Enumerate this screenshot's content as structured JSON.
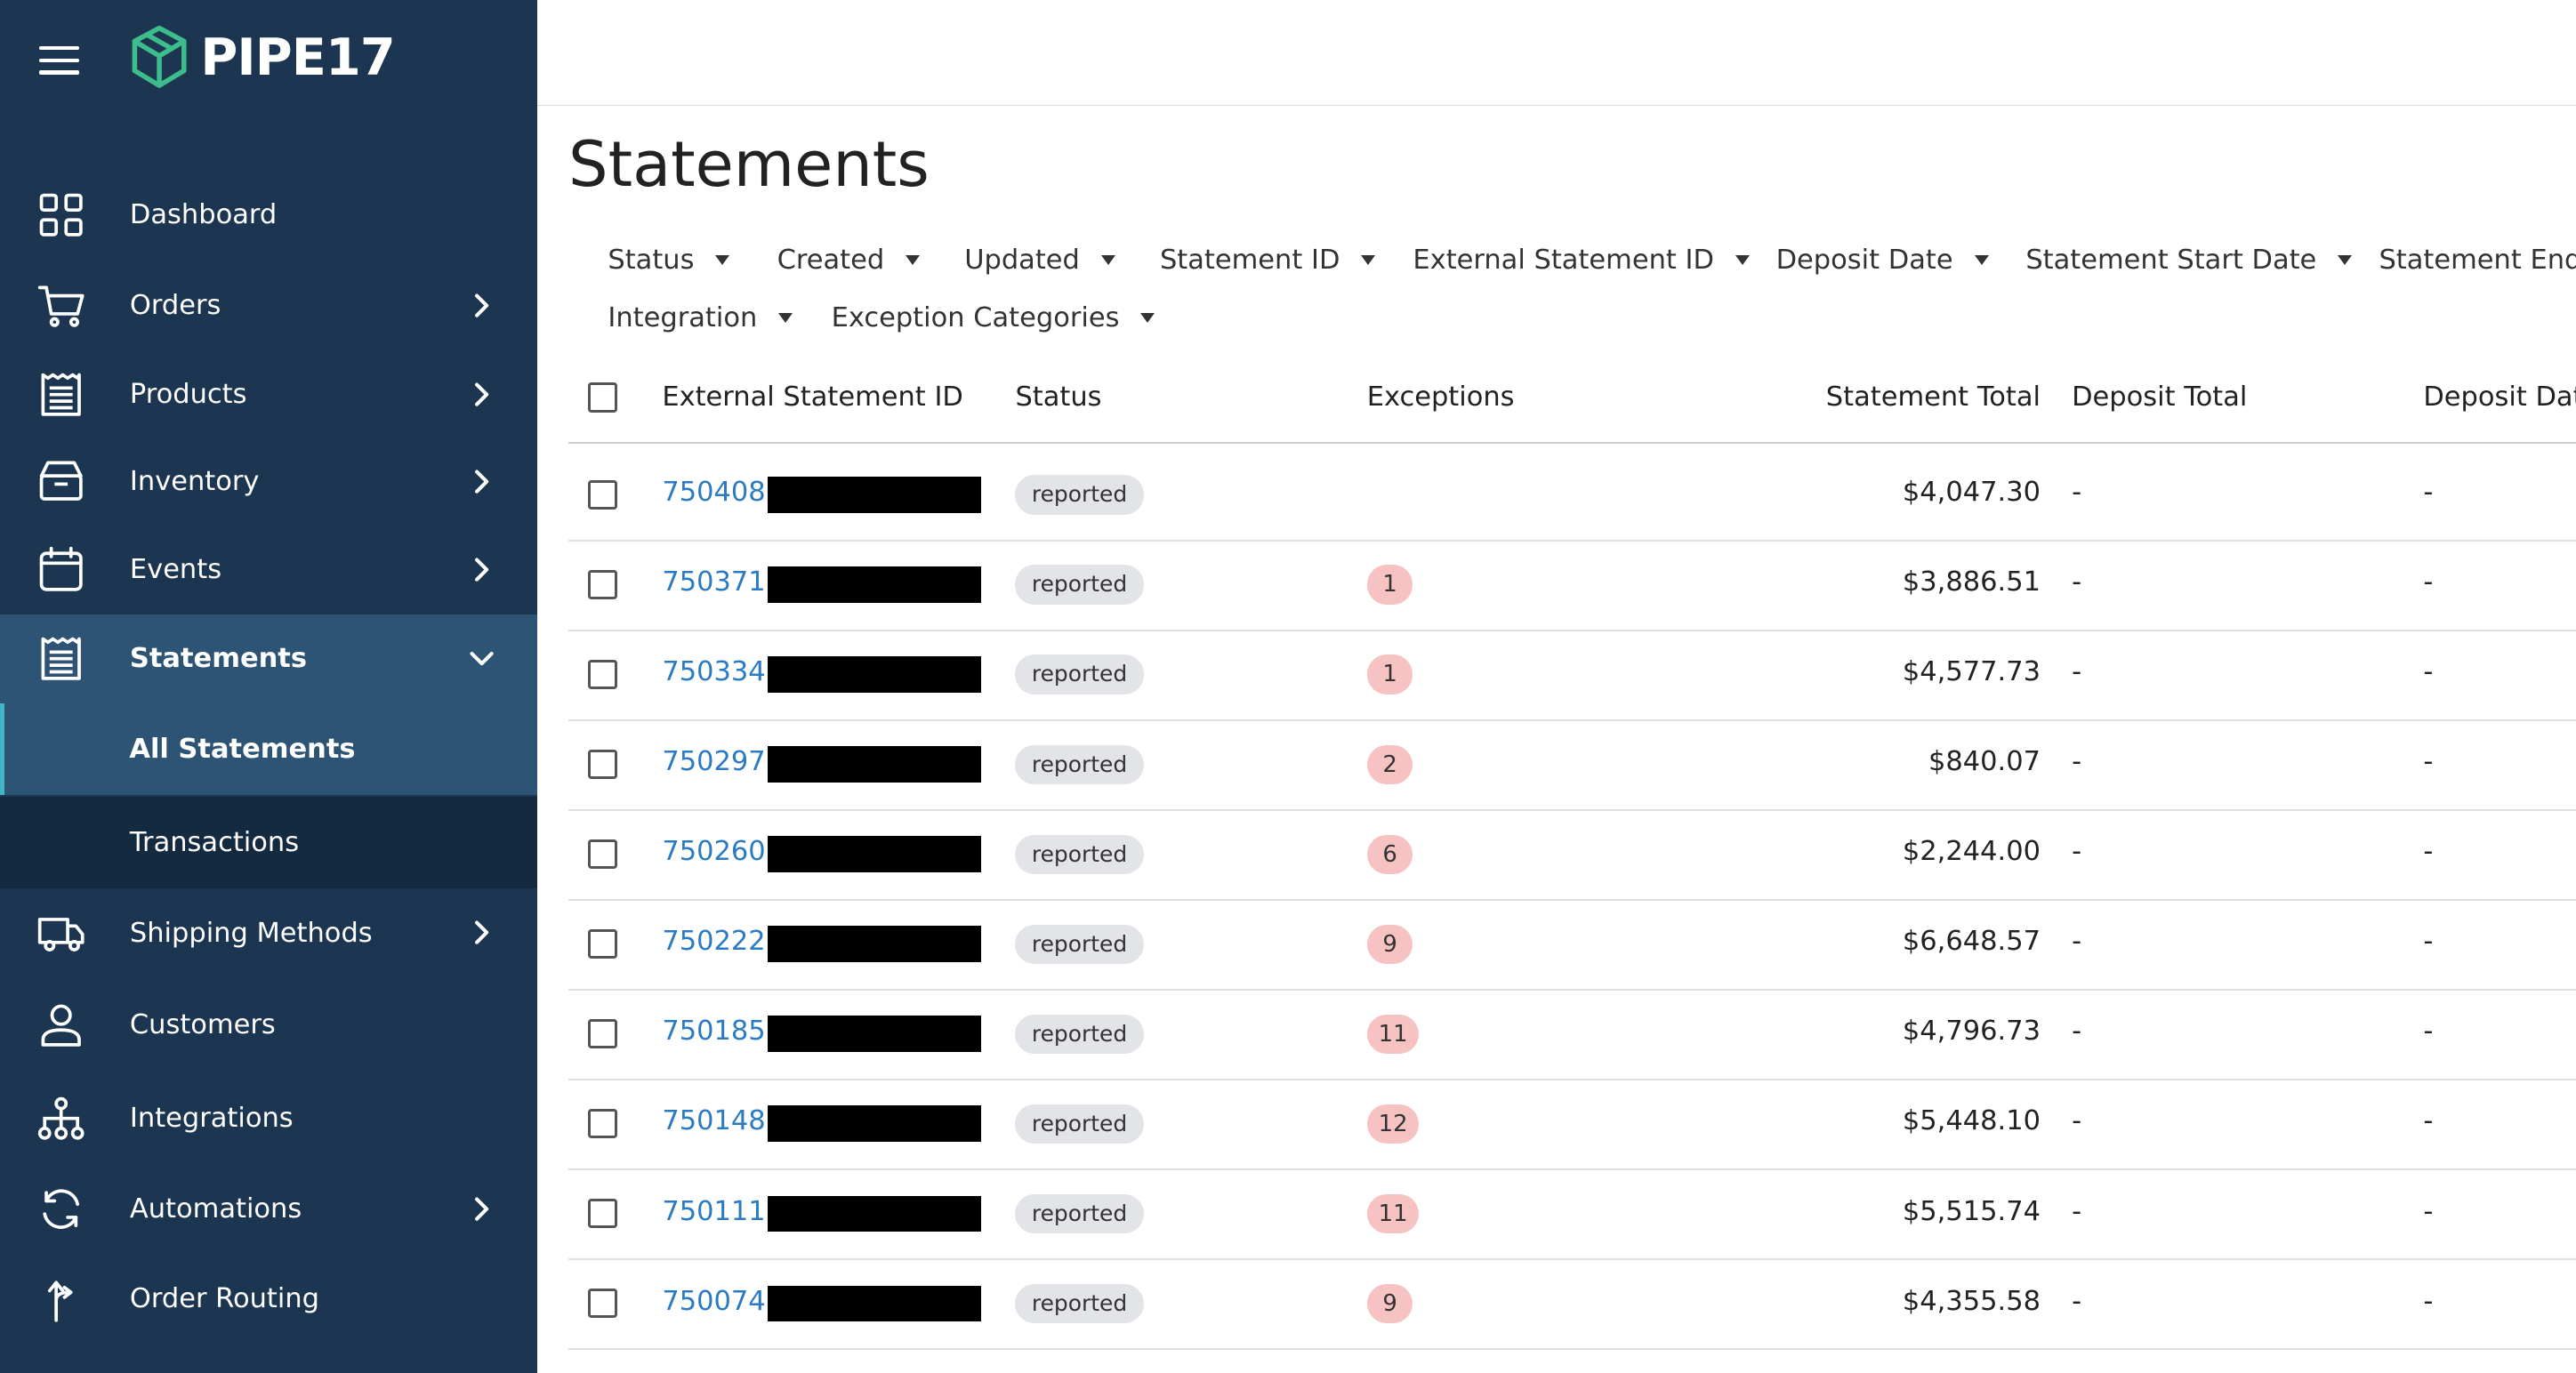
{
  "app": {
    "name": "PIPE17"
  },
  "sidebar": {
    "items": [
      {
        "label": "Dashboard",
        "icon": "dashboard-grid-icon",
        "has_chevron": false
      },
      {
        "label": "Orders",
        "icon": "cart-icon",
        "has_chevron": true
      },
      {
        "label": "Products",
        "icon": "products-list-icon",
        "has_chevron": true
      },
      {
        "label": "Inventory",
        "icon": "inventory-box-icon",
        "has_chevron": true
      },
      {
        "label": "Events",
        "icon": "calendar-icon",
        "has_chevron": true
      },
      {
        "label": "Statements",
        "icon": "statement-icon",
        "has_chevron": true,
        "expanded": true
      },
      {
        "label": "Shipping Methods",
        "icon": "truck-icon",
        "has_chevron": true
      },
      {
        "label": "Customers",
        "icon": "user-icon",
        "has_chevron": false
      },
      {
        "label": "Integrations",
        "icon": "hierarchy-icon",
        "has_chevron": false
      },
      {
        "label": "Automations",
        "icon": "refresh-icon",
        "has_chevron": true
      },
      {
        "label": "Order Routing",
        "icon": "routing-arrow-icon",
        "has_chevron": false
      }
    ],
    "statements_sub": [
      {
        "label": "All Statements",
        "active": true
      },
      {
        "label": "Transactions",
        "active": false
      }
    ]
  },
  "page": {
    "title": "Statements"
  },
  "filters": [
    "Status",
    "Created",
    "Updated",
    "Statement ID",
    "External Statement ID",
    "Deposit Date",
    "Statement Start Date",
    "Statement End D",
    "Integration",
    "Exception Categories"
  ],
  "table": {
    "headers": {
      "external_id": "External Statement ID",
      "status": "Status",
      "exceptions": "Exceptions",
      "statement_total": "Statement Total",
      "deposit_total": "Deposit Total",
      "deposit_date": "Deposit Date"
    },
    "rows": [
      {
        "id": "750408",
        "status": "reported",
        "exceptions": "",
        "total": "$4,047.30",
        "deposit_total": "-",
        "deposit_date": "-"
      },
      {
        "id": "750371",
        "status": "reported",
        "exceptions": "1",
        "total": "$3,886.51",
        "deposit_total": "-",
        "deposit_date": "-"
      },
      {
        "id": "750334",
        "status": "reported",
        "exceptions": "1",
        "total": "$4,577.73",
        "deposit_total": "-",
        "deposit_date": "-"
      },
      {
        "id": "750297",
        "status": "reported",
        "exceptions": "2",
        "total": "$840.07",
        "deposit_total": "-",
        "deposit_date": "-"
      },
      {
        "id": "750260",
        "status": "reported",
        "exceptions": "6",
        "total": "$2,244.00",
        "deposit_total": "-",
        "deposit_date": "-"
      },
      {
        "id": "750222",
        "status": "reported",
        "exceptions": "9",
        "total": "$6,648.57",
        "deposit_total": "-",
        "deposit_date": "-"
      },
      {
        "id": "750185",
        "status": "reported",
        "exceptions": "11",
        "total": "$4,796.73",
        "deposit_total": "-",
        "deposit_date": "-"
      },
      {
        "id": "750148",
        "status": "reported",
        "exceptions": "12",
        "total": "$5,448.10",
        "deposit_total": "-",
        "deposit_date": "-"
      },
      {
        "id": "750111",
        "status": "reported",
        "exceptions": "11",
        "total": "$5,515.74",
        "deposit_total": "-",
        "deposit_date": "-"
      },
      {
        "id": "750074",
        "status": "reported",
        "exceptions": "9",
        "total": "$4,355.58",
        "deposit_total": "-",
        "deposit_date": "-"
      }
    ]
  },
  "colors": {
    "sidebar_bg": "#1c3550",
    "sidebar_active": "#2e5475",
    "link": "#2a7bc4",
    "exception_badge": "#f6c2c2",
    "status_pill": "#e2e4e7",
    "logo_green": "#3dbd8c"
  }
}
